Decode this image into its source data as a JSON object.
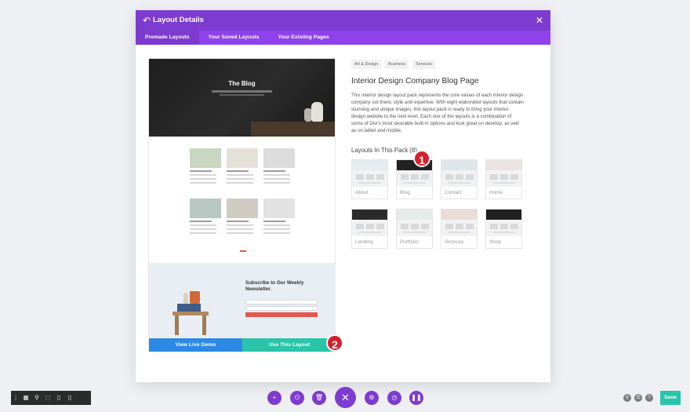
{
  "modal": {
    "title": "Layout Details",
    "back_icon": "back-arrow-icon",
    "close_icon": "close-icon",
    "tabs": [
      {
        "label": "Premade Layouts",
        "active": true
      },
      {
        "label": "Your Saved Layouts",
        "active": false
      },
      {
        "label": "Your Existing Pages",
        "active": false
      }
    ]
  },
  "preview": {
    "hero_title": "The Blog",
    "newsletter_title": "Subscribe to Our Weekly Newsletter.",
    "view_demo_label": "View Live Demo",
    "use_layout_label": "Use This Layout"
  },
  "details": {
    "tags": [
      "Art & Design",
      "Business",
      "Services"
    ],
    "title": "Interior Design Company Blog Page",
    "description": "This interior design layout pack represents the core values of each interior design company out there; style and expertise. With eight elaborated layouts that contain stunning and unique images, this layout pack is ready to bring your interior design website to the next level. Each one of the layouts is a combination of some of Divi's most desirable built-in options and look great on desktop, as well as on tablet and mobile.",
    "layouts_heading": "Layouts In This Pack (8)",
    "layouts": [
      "About",
      "Blog",
      "Contact",
      "Home",
      "Landing",
      "Portfolio",
      "Services",
      "Shop"
    ]
  },
  "annotations": {
    "step_one": "1",
    "step_two": "2"
  },
  "bottom_bar": {
    "left_icons": [
      "more-icon",
      "wireframe-icon",
      "zoom-icon",
      "desktop-icon",
      "tablet-icon",
      "phone-icon"
    ],
    "center_icons": [
      "add-icon",
      "power-icon",
      "trash-icon",
      "close-icon",
      "settings-icon",
      "history-icon",
      "pause-icon"
    ],
    "right_icons": [
      "search-icon",
      "layers-icon",
      "help-icon"
    ],
    "save_label": "Save"
  },
  "colors": {
    "header_purple": "#7e3bd0",
    "tabs_purple": "#8f42ec",
    "demo_blue": "#2c8ae5",
    "use_teal": "#29c4a9",
    "badge_red": "#d61f2c"
  }
}
